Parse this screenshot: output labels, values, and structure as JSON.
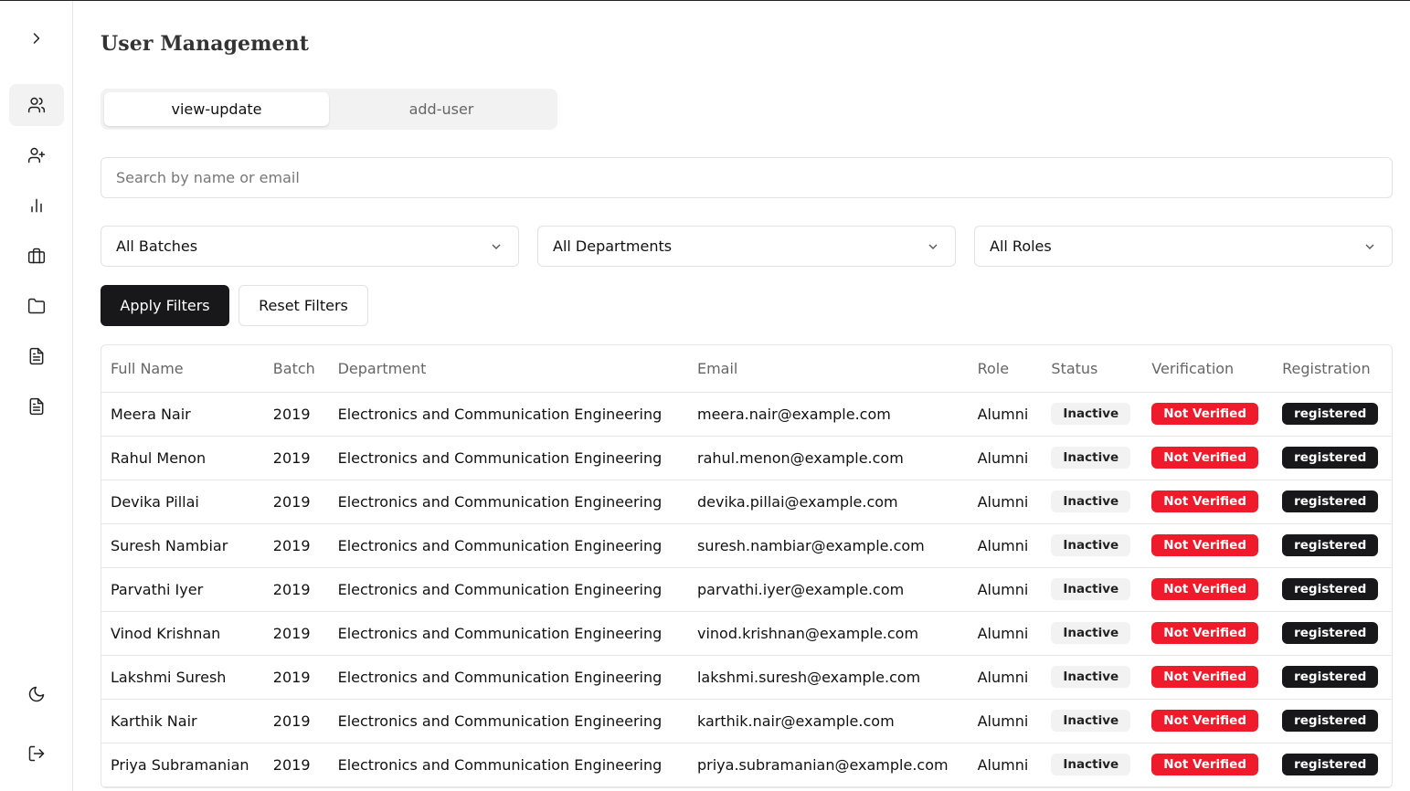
{
  "page_title": "User Management",
  "tabs": [
    {
      "label": "view-update",
      "active": true
    },
    {
      "label": "add-user",
      "active": false
    }
  ],
  "search": {
    "placeholder": "Search by name or email",
    "value": ""
  },
  "filters": {
    "batch": "All Batches",
    "department": "All Departments",
    "role": "All Roles"
  },
  "buttons": {
    "apply": "Apply Filters",
    "reset": "Reset Filters"
  },
  "sidebar": {
    "items": [
      {
        "icon": "users-icon",
        "active": true
      },
      {
        "icon": "user-plus-icon",
        "active": false
      },
      {
        "icon": "bar-chart-icon",
        "active": false
      },
      {
        "icon": "briefcase-icon",
        "active": false
      },
      {
        "icon": "folder-icon",
        "active": false
      },
      {
        "icon": "file-text-icon",
        "active": false
      },
      {
        "icon": "file-text-icon",
        "active": false
      }
    ],
    "bottom": [
      {
        "icon": "moon-icon"
      },
      {
        "icon": "logout-icon"
      }
    ]
  },
  "table": {
    "headers": [
      "Full Name",
      "Batch",
      "Department",
      "Email",
      "Role",
      "Status",
      "Verification",
      "Registration"
    ],
    "rows": [
      {
        "name": "Meera Nair",
        "batch": "2019",
        "department": "Electronics and Communication Engineering",
        "email": "meera.nair@example.com",
        "role": "Alumni",
        "status": "Inactive",
        "verification": "Not Verified",
        "registration": "registered"
      },
      {
        "name": "Rahul Menon",
        "batch": "2019",
        "department": "Electronics and Communication Engineering",
        "email": "rahul.menon@example.com",
        "role": "Alumni",
        "status": "Inactive",
        "verification": "Not Verified",
        "registration": "registered"
      },
      {
        "name": "Devika Pillai",
        "batch": "2019",
        "department": "Electronics and Communication Engineering",
        "email": "devika.pillai@example.com",
        "role": "Alumni",
        "status": "Inactive",
        "verification": "Not Verified",
        "registration": "registered"
      },
      {
        "name": "Suresh Nambiar",
        "batch": "2019",
        "department": "Electronics and Communication Engineering",
        "email": "suresh.nambiar@example.com",
        "role": "Alumni",
        "status": "Inactive",
        "verification": "Not Verified",
        "registration": "registered"
      },
      {
        "name": "Parvathi Iyer",
        "batch": "2019",
        "department": "Electronics and Communication Engineering",
        "email": "parvathi.iyer@example.com",
        "role": "Alumni",
        "status": "Inactive",
        "verification": "Not Verified",
        "registration": "registered"
      },
      {
        "name": "Vinod Krishnan",
        "batch": "2019",
        "department": "Electronics and Communication Engineering",
        "email": "vinod.krishnan@example.com",
        "role": "Alumni",
        "status": "Inactive",
        "verification": "Not Verified",
        "registration": "registered"
      },
      {
        "name": "Lakshmi Suresh",
        "batch": "2019",
        "department": "Electronics and Communication Engineering",
        "email": "lakshmi.suresh@example.com",
        "role": "Alumni",
        "status": "Inactive",
        "verification": "Not Verified",
        "registration": "registered"
      },
      {
        "name": "Karthik Nair",
        "batch": "2019",
        "department": "Electronics and Communication Engineering",
        "email": "karthik.nair@example.com",
        "role": "Alumni",
        "status": "Inactive",
        "verification": "Not Verified",
        "registration": "registered"
      },
      {
        "name": "Priya Subramanian",
        "batch": "2019",
        "department": "Electronics and Communication Engineering",
        "email": "priya.subramanian@example.com",
        "role": "Alumni",
        "status": "Inactive",
        "verification": "Not Verified",
        "registration": "registered"
      }
    ]
  },
  "colors": {
    "primary": "#18181b",
    "danger": "#ef1b2d",
    "muted_bg": "#f2f2f2",
    "border": "#e6e6e6"
  }
}
